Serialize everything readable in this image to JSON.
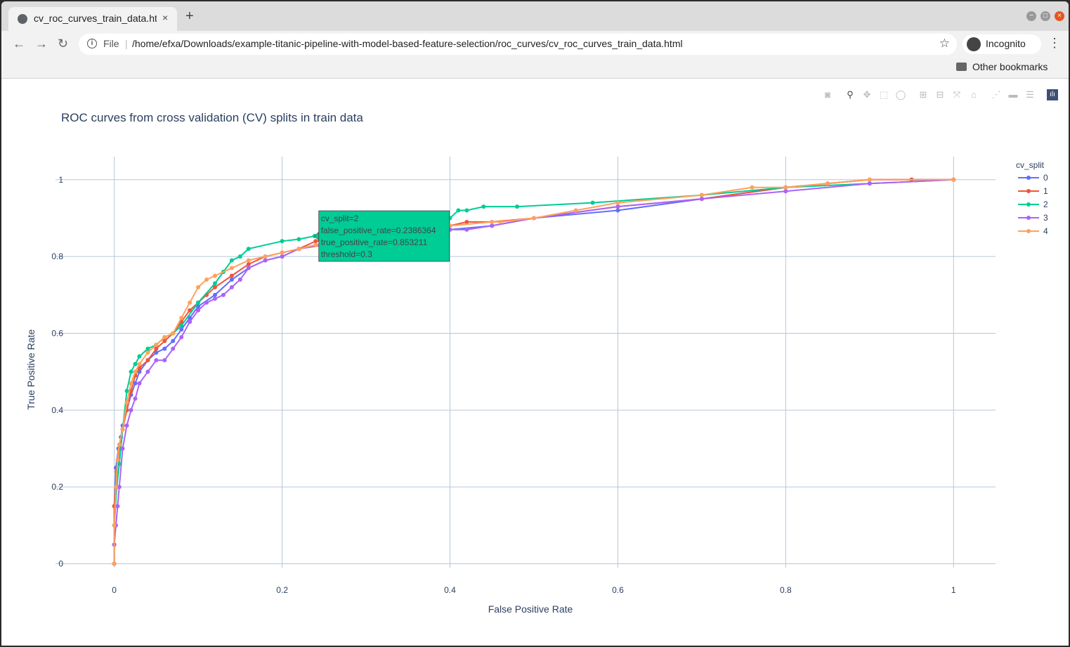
{
  "browser": {
    "tab_title": "cv_roc_curves_train_data.html",
    "tab_close": "×",
    "new_tab": "+",
    "scheme": "File",
    "url": "/home/efxa/Downloads/example-titanic-pipeline-with-model-based-feature-selection/roc_curves/cv_roc_curves_train_data.html",
    "incognito_label": "Incognito",
    "bookmark_folder": "Other bookmarks",
    "back_icon": "arrow-left-icon",
    "forward_icon": "arrow-right-icon",
    "reload_icon": "reload-icon"
  },
  "modebar": [
    "camera-icon",
    "zoom-icon",
    "pan-icon",
    "box-select-icon",
    "lasso-icon",
    "zoom-in-icon",
    "zoom-out-icon",
    "autoscale-icon",
    "reset-axes-icon",
    "spike-lines-icon",
    "hover-closest-icon",
    "hover-compare-icon",
    "plotly-logo-icon"
  ],
  "chart_data": {
    "type": "line",
    "title": "ROC curves from cross validation (CV) splits in train data",
    "xlabel": "False Positive Rate",
    "ylabel": "True Positive Rate",
    "xlim": [
      -0.07,
      1.05
    ],
    "ylim": [
      -0.01,
      1.06
    ],
    "x_ticks": [
      0,
      0.2,
      0.4,
      0.6,
      0.8,
      1
    ],
    "x_tick_labels": [
      "0",
      "0.2",
      "0.4",
      "0.6",
      "0.8",
      "1"
    ],
    "y_ticks": [
      0,
      0.2,
      0.4,
      0.6,
      0.8,
      1
    ],
    "y_tick_labels": [
      "0",
      "0.2",
      "0.4",
      "0.6",
      "0.8",
      "1"
    ],
    "grid": true,
    "legend_title": "cv_split",
    "legend_position": "top-right",
    "series": [
      {
        "name": "0",
        "color": "#636efa",
        "x": [
          0,
          0,
          0,
          0.002,
          0.005,
          0.008,
          0.01,
          0.015,
          0.02,
          0.025,
          0.03,
          0.04,
          0.05,
          0.06,
          0.07,
          0.08,
          0.09,
          0.1,
          0.12,
          0.14,
          0.16,
          0.18,
          0.2,
          0.22,
          0.24,
          0.26,
          0.3,
          0.35,
          0.4,
          0.45,
          0.5,
          0.6,
          0.7,
          0.8,
          0.85,
          0.9,
          0.95,
          1
        ],
        "y": [
          0,
          0.05,
          0.15,
          0.25,
          0.3,
          0.33,
          0.36,
          0.4,
          0.44,
          0.47,
          0.5,
          0.53,
          0.55,
          0.56,
          0.58,
          0.61,
          0.64,
          0.67,
          0.7,
          0.74,
          0.77,
          0.79,
          0.8,
          0.82,
          0.83,
          0.84,
          0.85,
          0.86,
          0.87,
          0.88,
          0.9,
          0.92,
          0.95,
          0.98,
          0.99,
          1,
          1,
          1
        ]
      },
      {
        "name": "1",
        "color": "#ef553b",
        "x": [
          0,
          0,
          0,
          0.003,
          0.006,
          0.01,
          0.015,
          0.02,
          0.025,
          0.03,
          0.04,
          0.05,
          0.06,
          0.07,
          0.08,
          0.09,
          0.1,
          0.11,
          0.12,
          0.14,
          0.16,
          0.18,
          0.2,
          0.22,
          0.24,
          0.28,
          0.32,
          0.36,
          0.4,
          0.42,
          0.45,
          0.5,
          0.6,
          0.7,
          0.8,
          0.85,
          0.9,
          0.95,
          1
        ],
        "y": [
          0,
          0.05,
          0.15,
          0.24,
          0.3,
          0.35,
          0.4,
          0.45,
          0.49,
          0.51,
          0.53,
          0.56,
          0.58,
          0.6,
          0.63,
          0.66,
          0.68,
          0.7,
          0.72,
          0.75,
          0.78,
          0.8,
          0.81,
          0.82,
          0.84,
          0.85,
          0.86,
          0.87,
          0.88,
          0.89,
          0.89,
          0.9,
          0.93,
          0.95,
          0.98,
          0.99,
          1,
          1,
          1
        ]
      },
      {
        "name": "2",
        "color": "#00cc96",
        "x": [
          0,
          0,
          0.003,
          0.006,
          0.01,
          0.015,
          0.02,
          0.025,
          0.03,
          0.04,
          0.05,
          0.06,
          0.07,
          0.08,
          0.1,
          0.12,
          0.13,
          0.14,
          0.15,
          0.16,
          0.2,
          0.22,
          0.2386364,
          0.26,
          0.3,
          0.35,
          0.4,
          0.41,
          0.42,
          0.44,
          0.48,
          0.57,
          0.7,
          0.8,
          0.9,
          1
        ],
        "y": [
          0,
          0.1,
          0.2,
          0.26,
          0.35,
          0.45,
          0.5,
          0.52,
          0.54,
          0.56,
          0.57,
          0.59,
          0.6,
          0.62,
          0.68,
          0.73,
          0.76,
          0.79,
          0.8,
          0.82,
          0.84,
          0.845,
          0.853211,
          0.86,
          0.87,
          0.88,
          0.9,
          0.92,
          0.92,
          0.93,
          0.93,
          0.94,
          0.96,
          0.98,
          0.99,
          1
        ]
      },
      {
        "name": "3",
        "color": "#ab63fa",
        "x": [
          0,
          0,
          0.002,
          0.004,
          0.006,
          0.01,
          0.015,
          0.02,
          0.025,
          0.03,
          0.04,
          0.05,
          0.06,
          0.07,
          0.08,
          0.09,
          0.1,
          0.11,
          0.12,
          0.13,
          0.14,
          0.15,
          0.16,
          0.18,
          0.2,
          0.22,
          0.25,
          0.3,
          0.35,
          0.4,
          0.42,
          0.45,
          0.5,
          0.6,
          0.7,
          0.8,
          0.9,
          1
        ],
        "y": [
          0,
          0.05,
          0.1,
          0.15,
          0.2,
          0.3,
          0.36,
          0.4,
          0.43,
          0.47,
          0.5,
          0.53,
          0.53,
          0.56,
          0.59,
          0.63,
          0.66,
          0.68,
          0.69,
          0.7,
          0.72,
          0.74,
          0.77,
          0.79,
          0.8,
          0.82,
          0.83,
          0.84,
          0.85,
          0.87,
          0.87,
          0.88,
          0.9,
          0.93,
          0.95,
          0.97,
          0.99,
          1
        ]
      },
      {
        "name": "4",
        "color": "#ffa15a",
        "x": [
          0,
          0,
          0.002,
          0.004,
          0.006,
          0.01,
          0.015,
          0.02,
          0.025,
          0.03,
          0.04,
          0.05,
          0.06,
          0.07,
          0.08,
          0.09,
          0.1,
          0.11,
          0.12,
          0.14,
          0.16,
          0.18,
          0.2,
          0.22,
          0.24,
          0.28,
          0.32,
          0.36,
          0.4,
          0.45,
          0.46,
          0.5,
          0.55,
          0.6,
          0.7,
          0.76,
          0.8,
          0.85,
          0.9,
          1
        ],
        "y": [
          0,
          0.1,
          0.2,
          0.27,
          0.31,
          0.35,
          0.42,
          0.47,
          0.5,
          0.52,
          0.55,
          0.57,
          0.59,
          0.6,
          0.64,
          0.68,
          0.72,
          0.74,
          0.75,
          0.77,
          0.79,
          0.8,
          0.81,
          0.82,
          0.83,
          0.85,
          0.86,
          0.87,
          0.88,
          0.89,
          0.89,
          0.9,
          0.92,
          0.94,
          0.96,
          0.98,
          0.98,
          0.99,
          1,
          1
        ]
      }
    ],
    "hover": {
      "series": "2",
      "x": 0.2386364,
      "y": 0.853211,
      "color": "#00cc96",
      "lines": [
        "cv_split=2",
        "false_positive_rate=0.2386364",
        "true_positive_rate=0.853211",
        "threshold=0.3"
      ]
    }
  }
}
